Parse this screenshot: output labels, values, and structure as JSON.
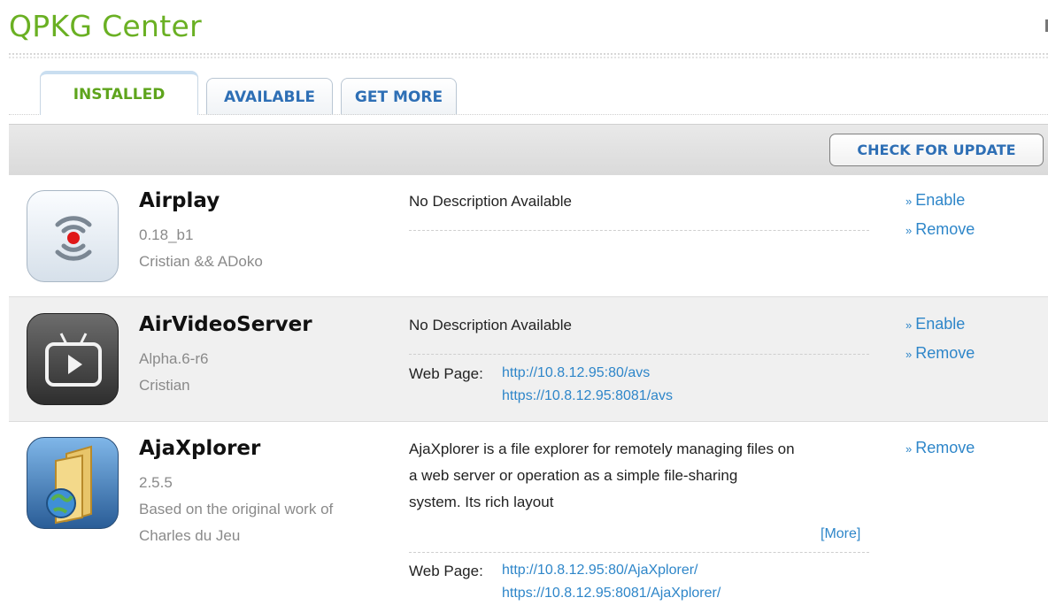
{
  "header": {
    "title": "QPKG Center"
  },
  "tabs": [
    {
      "label": "INSTALLED",
      "active": true
    },
    {
      "label": "AVAILABLE",
      "active": false
    },
    {
      "label": "GET MORE",
      "active": false
    }
  ],
  "toolbar": {
    "check_update_label": "CHECK FOR UPDATE"
  },
  "action_prefix": "»",
  "apps": [
    {
      "name": "Airplay",
      "version": "0.18_b1",
      "author": "Cristian && ADoko",
      "description": "No Description Available",
      "actions": [
        "Enable",
        "Remove"
      ],
      "icon": "airplay-icon"
    },
    {
      "name": "AirVideoServer",
      "version": "Alpha.6-r6",
      "author": "Cristian",
      "description": "No Description Available",
      "web_page_label": "Web Page:",
      "links": [
        "http://10.8.12.95:80/avs",
        "https://10.8.12.95:8081/avs"
      ],
      "actions": [
        "Enable",
        "Remove"
      ],
      "icon": "tv-play-icon"
    },
    {
      "name": "AjaXplorer",
      "version": "2.5.5",
      "author_lines": [
        "Based on the original work of",
        "Charles du Jeu"
      ],
      "description_lines": [
        "AjaXplorer is a file explorer for remotely managing files on",
        "a web server or operation as a simple file-sharing",
        "system. Its rich layout"
      ],
      "more_label": "[More]",
      "web_page_label": "Web Page:",
      "links": [
        "http://10.8.12.95:80/AjaXplorer/",
        "https://10.8.12.95:8081/AjaXplorer/"
      ],
      "actions": [
        "Remove"
      ],
      "icon": "folder-globe-icon"
    }
  ],
  "colors": {
    "title_green": "#6ab023",
    "active_tab_green": "#5ea41c",
    "tab_blue": "#2e6fb5",
    "link_blue": "#2e86c9"
  }
}
